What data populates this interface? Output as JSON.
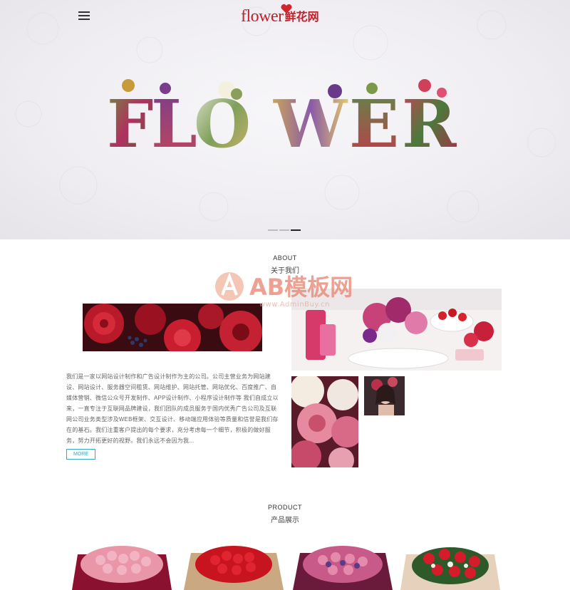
{
  "header": {
    "logo_en": "flower",
    "logo_cn": "鲜花网"
  },
  "banner": {
    "word": "FLOWER",
    "slides": 3,
    "active_slide": 3
  },
  "about": {
    "title_en": "ABOUT",
    "title_cn": "关于我们",
    "text": "我们是一家以网站设计制作和广告设计制作为主的公司。公司主营业务为网站建设、网站设计、服务器空间租赁、网站维护、网站托管、网站优化、百度推广、自媒体营销、微信公众号开发制作、APP设计制作、小程序设计制作等 我们自成立以来，一直专注于互联网品牌建设，我们团队的成员服务于国内优秀广告公司及互联网公司业务类型涉及WEB框架、交互设计、移动端应用体验等质量和信誉是我们存在的基石。我们注重客户提出的每个要求，充分考虑每一个细节，积极的做好服务，努力开拓更好的视野。我们永远不会因为我...",
    "more_label": "MORE"
  },
  "watermark": {
    "brand": "AB模板网",
    "url": "www.AdminBuy.cn"
  },
  "product": {
    "title_en": "PRODUCT",
    "title_cn": "产品展示"
  },
  "colors": {
    "brand_red": "#c0202a",
    "accent_teal": "#3aa9b8"
  }
}
